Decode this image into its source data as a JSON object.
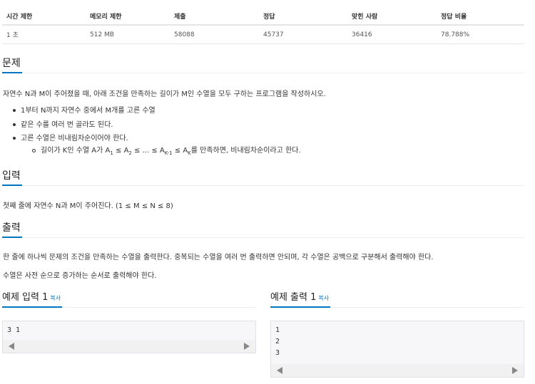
{
  "stats": {
    "headers": [
      "시간 제한",
      "메모리 제한",
      "제출",
      "정답",
      "맞힌 사람",
      "정답 비율"
    ],
    "values": [
      "1 초",
      "512 MB",
      "58088",
      "45737",
      "36416",
      "78.788%"
    ]
  },
  "problem": {
    "title": "문제",
    "description": "자연수 N과 M이 주어졌을 때, 아래 조건을 만족하는 길이가 M인 수열을 모두 구하는 프로그램을 작성하시오.",
    "conditions": [
      "1부터 N까지 자연수 중에서 M개를 고른 수열",
      "같은 수를 여러 번 골라도 된다.",
      "고른 수열은 비내림차순이어야 한다."
    ],
    "sub_condition": {
      "prefix": "길이가 K인 수열 A가 A",
      "s1": "1",
      "mid1": " ≤ A",
      "s2": "2",
      "mid2": " ≤ ... ≤ A",
      "s3": "K-1",
      "mid3": " ≤ A",
      "s4": "K",
      "suffix": "를 만족하면, 비내림차순이라고 한다."
    }
  },
  "input": {
    "title": "입력",
    "description": "첫째 줄에 자연수 N과 M이 주어진다. (1 ≤ M ≤ N ≤ 8)"
  },
  "output": {
    "title": "출력",
    "line1": "한 줄에 하나씩 문제의 조건을 만족하는 수열을 출력한다. 중복되는 수열을 여러 번 출력하면 안되며, 각 수열은 공백으로 구분해서 출력해야 한다.",
    "line2": "수열은 사전 순으로 증가하는 순서로 출력해야 한다."
  },
  "sample_input": {
    "title": "예제 입력 1",
    "copy_label": "복사",
    "lines": [
      "3 1"
    ]
  },
  "sample_output": {
    "title": "예제 출력 1",
    "copy_label": "복사",
    "lines": [
      "1",
      "2",
      "3"
    ]
  }
}
